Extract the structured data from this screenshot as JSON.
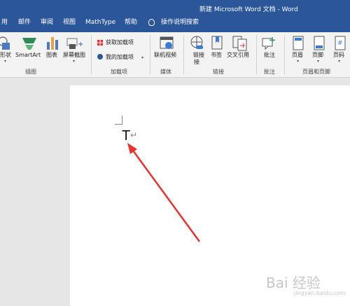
{
  "window": {
    "title": "新建 Microsoft Word 文档  -  Word"
  },
  "tabs": [
    "用",
    "邮件",
    "审阅",
    "视图",
    "MathType",
    "帮助"
  ],
  "tell_me": "操作说明搜索",
  "ribbon": {
    "illustrations": {
      "shapes": "形状",
      "smartart": "SmartArt",
      "chart": "图表",
      "screenshot": "屏幕截图",
      "label": "插图"
    },
    "addins": {
      "get": "获取加载项",
      "my": "我的加载项",
      "label": "加载项"
    },
    "media": {
      "online_video": "联机视频",
      "label": "媒体"
    },
    "links": {
      "link": "链接",
      "bookmark": "书签",
      "crossref": "交叉引用",
      "label": "链接"
    },
    "comments": {
      "comment": "批注",
      "label": "批注"
    },
    "header_footer": {
      "header": "页眉",
      "footer": "页脚",
      "page_number": "页码",
      "label": "页眉和页脚"
    }
  },
  "document": {
    "text": "T",
    "paragraph_mark": "↵"
  },
  "watermark": {
    "main": "Bai 经验",
    "sub": "jingyan.baidu.com"
  },
  "colors": {
    "accent": "#2b579a",
    "annotation_arrow": "#e8322f"
  }
}
